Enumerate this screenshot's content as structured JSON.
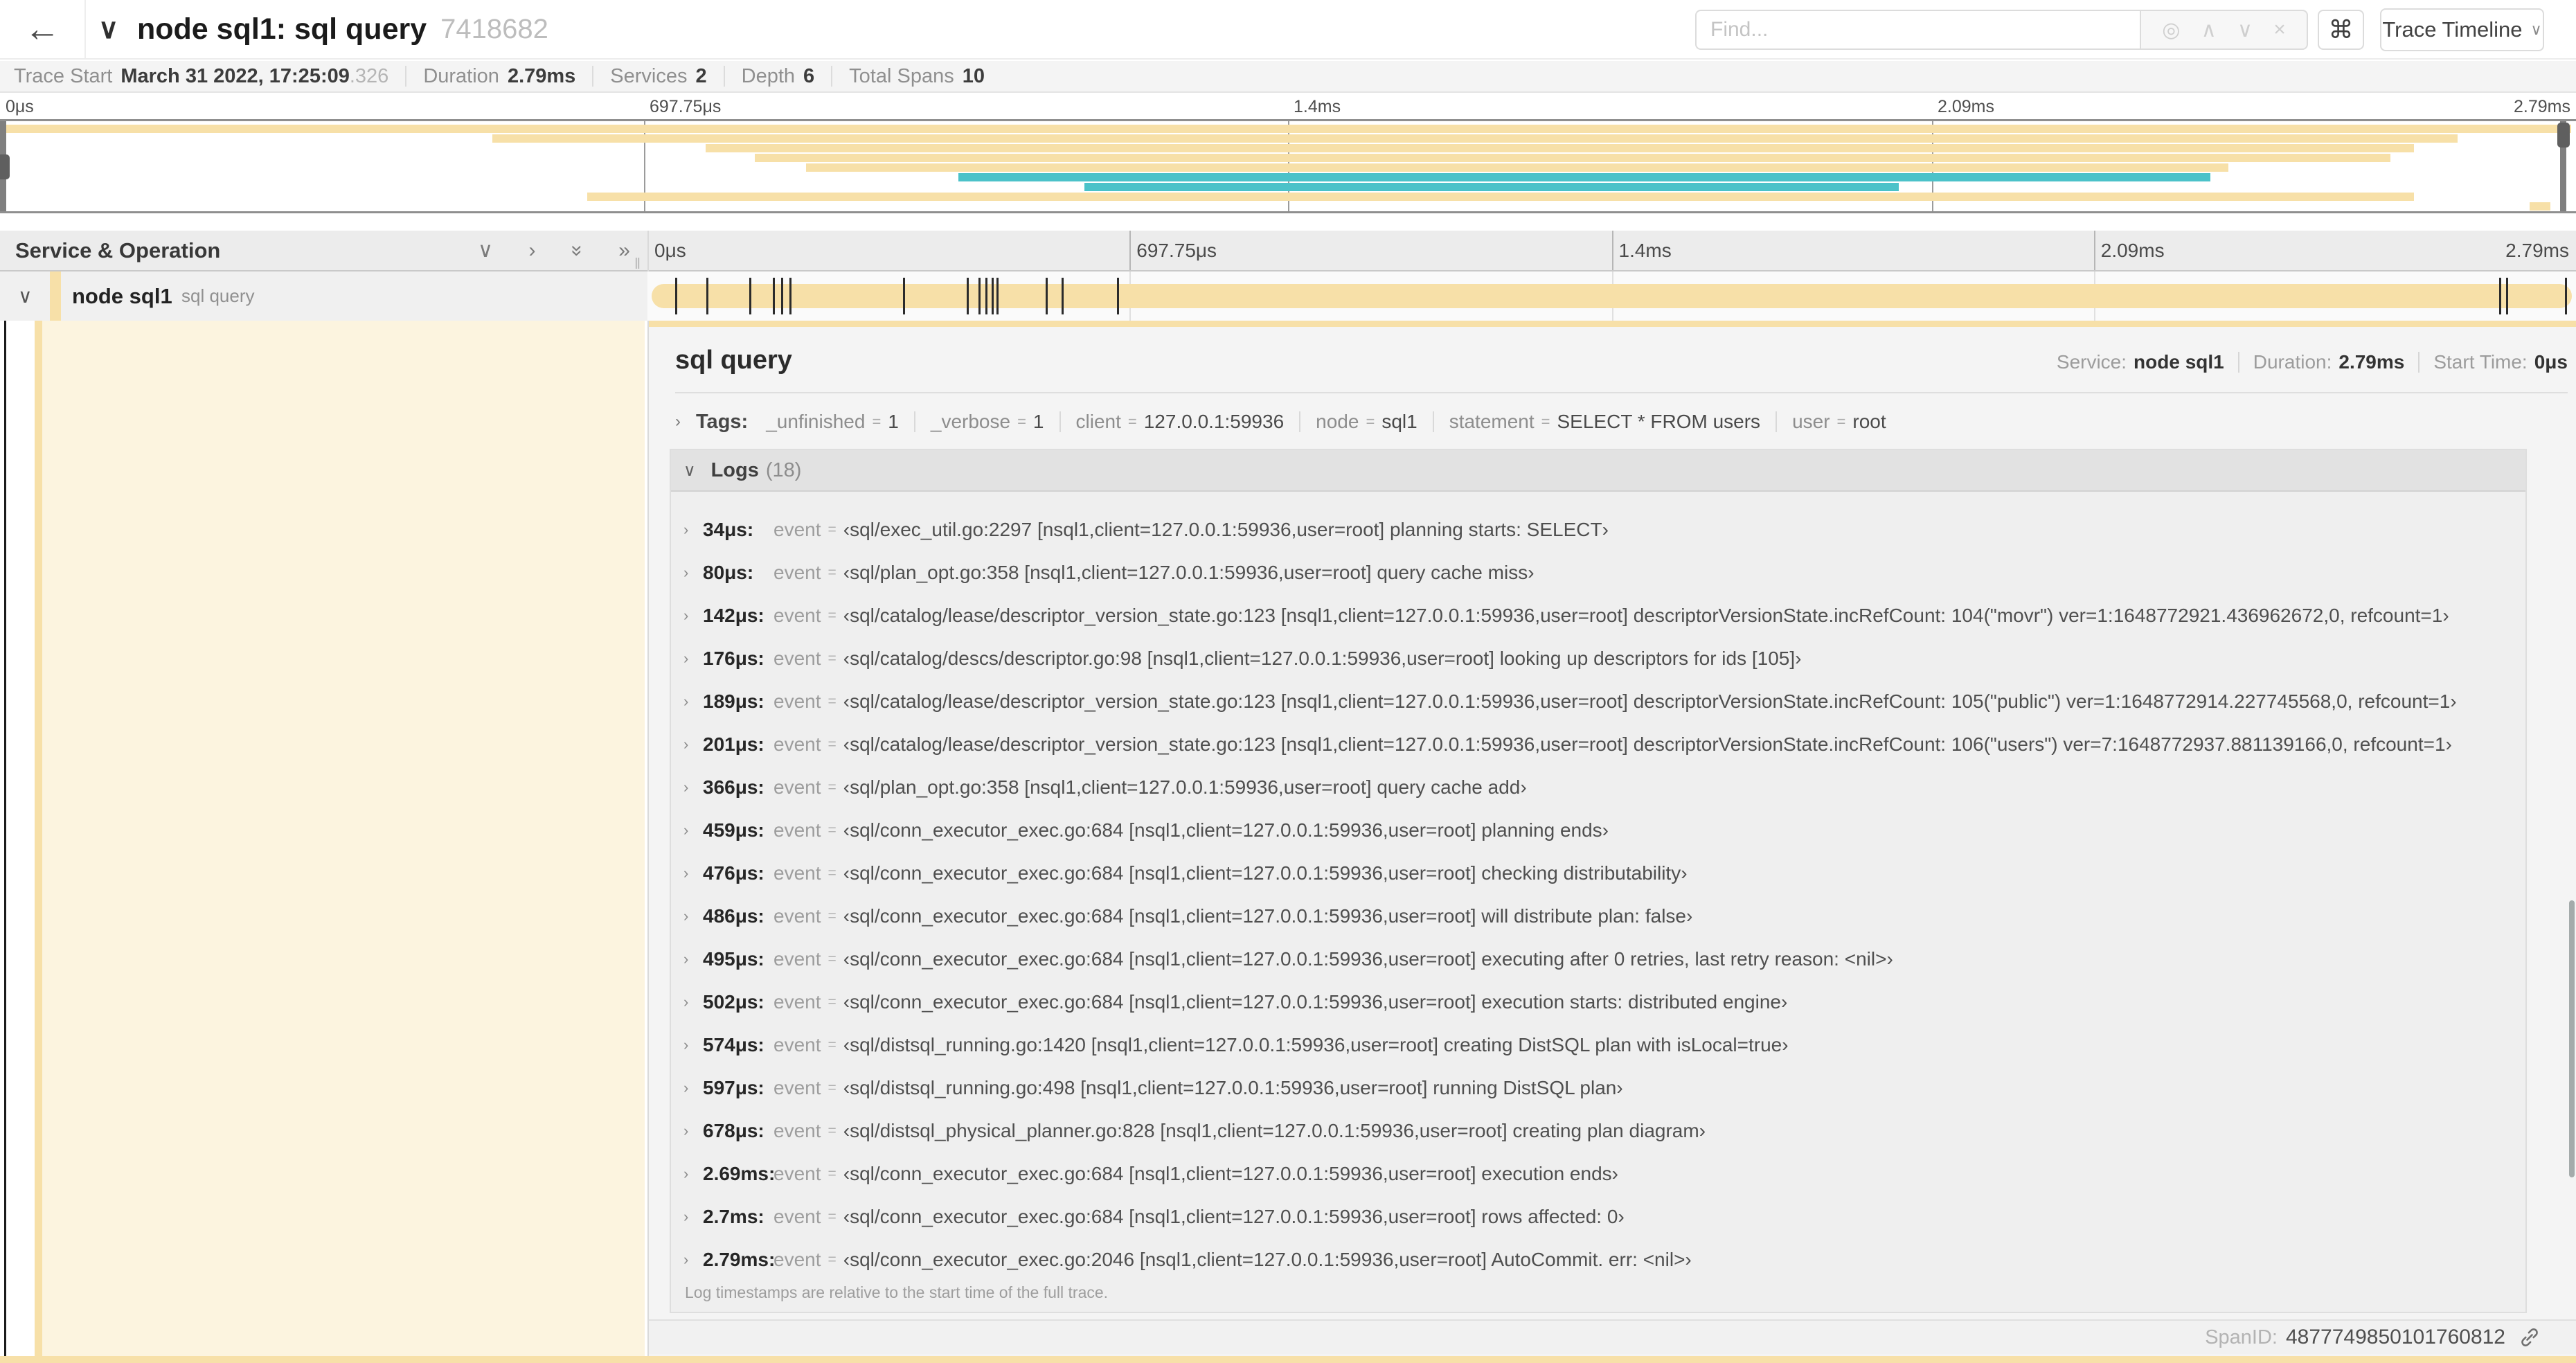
{
  "colors": {
    "tan": "#F7E0A8",
    "teal": "#4BC2C9",
    "cream": "#FCF4DF"
  },
  "header": {
    "back_icon": "←",
    "collapse_icon": "∨",
    "title": "node sql1: sql query",
    "trace_id": "7418682",
    "find_placeholder": "Find...",
    "find_icons": [
      "◎",
      "∧",
      "∨",
      "×"
    ],
    "shortcut_icon": "⌘",
    "view_label": "Trace Timeline",
    "view_caret": "∨"
  },
  "trace_info": {
    "items": [
      {
        "label": "Trace Start",
        "value": "March 31 2022, 17:25:09",
        "suffix": ".326"
      },
      {
        "label": "Duration",
        "value": "2.79ms"
      },
      {
        "label": "Services",
        "value": "2"
      },
      {
        "label": "Depth",
        "value": "6"
      },
      {
        "label": "Total Spans",
        "value": "10"
      }
    ]
  },
  "ruler_ticks": [
    {
      "label": "0μs",
      "pct": 0
    },
    {
      "label": "697.75μs",
      "pct": 25
    },
    {
      "label": "1.4ms",
      "pct": 50
    },
    {
      "label": "2.09ms",
      "pct": 75
    },
    {
      "label": "2.79ms",
      "pct": 100
    }
  ],
  "minimap": {
    "spans": [
      {
        "start": 0.002,
        "end": 0.998,
        "color": "tan"
      },
      {
        "start": 0.191,
        "end": 0.954,
        "color": "tan"
      },
      {
        "start": 0.274,
        "end": 0.937,
        "color": "tan"
      },
      {
        "start": 0.293,
        "end": 0.928,
        "color": "tan"
      },
      {
        "start": 0.313,
        "end": 0.865,
        "color": "tan"
      },
      {
        "start": 0.372,
        "end": 0.858,
        "color": "teal"
      },
      {
        "start": 0.421,
        "end": 0.737,
        "color": "teal"
      },
      {
        "start": 0.228,
        "end": 0.937,
        "color": "tan"
      },
      {
        "start": 0.982,
        "end": 0.99,
        "color": "tan"
      }
    ]
  },
  "timeline": {
    "col_header": "Service & Operation",
    "col_icons": [
      "chevron-down",
      "chevron-right",
      "double-chevron-down",
      "double-chevron-right"
    ]
  },
  "span_row": {
    "service": "node sql1",
    "operation": "sql query",
    "total_us": 2790,
    "log_marks_us": [
      34,
      80,
      142,
      176,
      189,
      201,
      366,
      459,
      476,
      486,
      495,
      502,
      574,
      597,
      678,
      2690,
      2700,
      2786
    ]
  },
  "detail": {
    "title": "sql query",
    "meta": [
      {
        "label": "Service:",
        "value": "node sql1"
      },
      {
        "label": "Duration:",
        "value": "2.79ms"
      },
      {
        "label": "Start Time:",
        "value": "0μs"
      }
    ],
    "tags_label": "Tags:",
    "tags": [
      {
        "key": "_unfinished",
        "value": "1"
      },
      {
        "key": "_verbose",
        "value": "1"
      },
      {
        "key": "client",
        "value": "127.0.0.1:59936"
      },
      {
        "key": "node",
        "value": "sql1"
      },
      {
        "key": "statement",
        "value": "SELECT * FROM users"
      },
      {
        "key": "user",
        "value": "root"
      }
    ],
    "logs_label": "Logs",
    "logs_count": "(18)",
    "logs": [
      {
        "t": "34μs:",
        "key": "event",
        "value": "‹sql/exec_util.go:2297 [nsql1,client=127.0.0.1:59936,user=root] planning starts: SELECT›"
      },
      {
        "t": "80μs:",
        "key": "event",
        "value": "‹sql/plan_opt.go:358 [nsql1,client=127.0.0.1:59936,user=root] query cache miss›"
      },
      {
        "t": "142μs:",
        "key": "event",
        "value": "‹sql/catalog/lease/descriptor_version_state.go:123 [nsql1,client=127.0.0.1:59936,user=root] descriptorVersionState.incRefCount: 104(\"movr\") ver=1:1648772921.436962672,0, refcount=1›"
      },
      {
        "t": "176μs:",
        "key": "event",
        "value": "‹sql/catalog/descs/descriptor.go:98 [nsql1,client=127.0.0.1:59936,user=root] looking up descriptors for ids [105]›"
      },
      {
        "t": "189μs:",
        "key": "event",
        "value": "‹sql/catalog/lease/descriptor_version_state.go:123 [nsql1,client=127.0.0.1:59936,user=root] descriptorVersionState.incRefCount: 105(\"public\") ver=1:1648772914.227745568,0, refcount=1›"
      },
      {
        "t": "201μs:",
        "key": "event",
        "value": "‹sql/catalog/lease/descriptor_version_state.go:123 [nsql1,client=127.0.0.1:59936,user=root] descriptorVersionState.incRefCount: 106(\"users\") ver=7:1648772937.881139166,0, refcount=1›"
      },
      {
        "t": "366μs:",
        "key": "event",
        "value": "‹sql/plan_opt.go:358 [nsql1,client=127.0.0.1:59936,user=root] query cache add›"
      },
      {
        "t": "459μs:",
        "key": "event",
        "value": "‹sql/conn_executor_exec.go:684 [nsql1,client=127.0.0.1:59936,user=root] planning ends›"
      },
      {
        "t": "476μs:",
        "key": "event",
        "value": "‹sql/conn_executor_exec.go:684 [nsql1,client=127.0.0.1:59936,user=root] checking distributability›"
      },
      {
        "t": "486μs:",
        "key": "event",
        "value": "‹sql/conn_executor_exec.go:684 [nsql1,client=127.0.0.1:59936,user=root] will distribute plan: false›"
      },
      {
        "t": "495μs:",
        "key": "event",
        "value": "‹sql/conn_executor_exec.go:684 [nsql1,client=127.0.0.1:59936,user=root] executing after 0 retries, last retry reason: <nil>›"
      },
      {
        "t": "502μs:",
        "key": "event",
        "value": "‹sql/conn_executor_exec.go:684 [nsql1,client=127.0.0.1:59936,user=root] execution starts: distributed engine›"
      },
      {
        "t": "574μs:",
        "key": "event",
        "value": "‹sql/distsql_running.go:1420 [nsql1,client=127.0.0.1:59936,user=root] creating DistSQL plan with isLocal=true›"
      },
      {
        "t": "597μs:",
        "key": "event",
        "value": "‹sql/distsql_running.go:498 [nsql1,client=127.0.0.1:59936,user=root] running DistSQL plan›"
      },
      {
        "t": "678μs:",
        "key": "event",
        "value": "‹sql/distsql_physical_planner.go:828 [nsql1,client=127.0.0.1:59936,user=root] creating plan diagram›"
      },
      {
        "t": "2.69ms:",
        "key": "event",
        "value": "‹sql/conn_executor_exec.go:684 [nsql1,client=127.0.0.1:59936,user=root] execution ends›"
      },
      {
        "t": "2.7ms:",
        "key": "event",
        "value": "‹sql/conn_executor_exec.go:684 [nsql1,client=127.0.0.1:59936,user=root] rows affected: 0›"
      },
      {
        "t": "2.79ms:",
        "key": "event",
        "value": "‹sql/conn_executor_exec.go:2046 [nsql1,client=127.0.0.1:59936,user=root] AutoCommit. err: <nil>›"
      }
    ],
    "logs_footer": "Log timestamps are relative to the start time of the full trace.",
    "span_id_label": "SpanID:",
    "span_id": "4877749850101760812"
  }
}
